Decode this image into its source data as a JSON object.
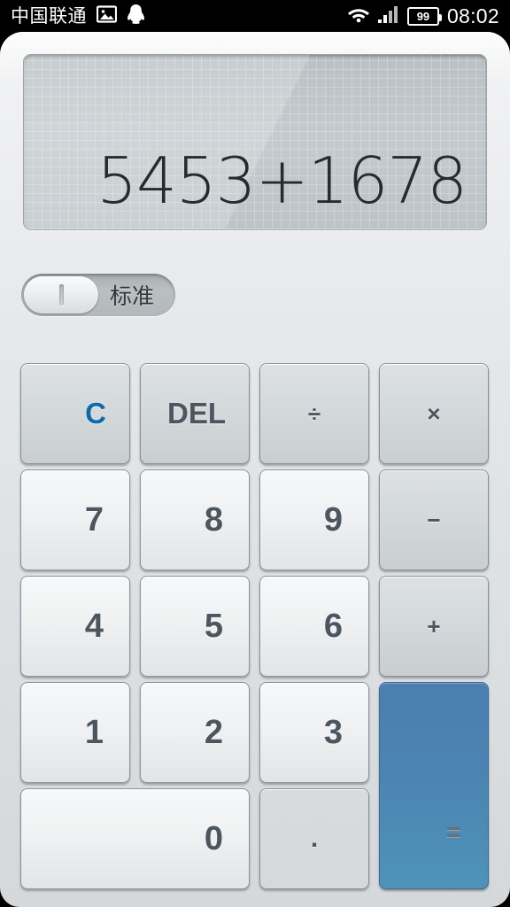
{
  "statusbar": {
    "carrier": "中国联通",
    "icons": [
      "photo-icon",
      "qq-penguin-icon",
      "wifi-icon",
      "signal-icon"
    ],
    "battery_level": "99",
    "time": "08:02"
  },
  "calculator": {
    "display_value": "5453+1678",
    "mode_toggle": {
      "label": "标准",
      "state": "on"
    },
    "accent_color": "#4b84b2",
    "clear_color": "#0f6aa8",
    "keys": [
      {
        "id": "clear",
        "label": "C",
        "type": "func",
        "row": 0,
        "col": 0,
        "span": 1
      },
      {
        "id": "delete",
        "label": "DEL",
        "type": "func",
        "row": 0,
        "col": 1,
        "span": 1
      },
      {
        "id": "divide",
        "label": "÷",
        "type": "op",
        "row": 0,
        "col": 2,
        "span": 1
      },
      {
        "id": "multiply",
        "label": "×",
        "type": "op",
        "row": 0,
        "col": 3,
        "span": 1
      },
      {
        "id": "seven",
        "label": "7",
        "type": "digit",
        "row": 1,
        "col": 0,
        "span": 1
      },
      {
        "id": "eight",
        "label": "8",
        "type": "digit",
        "row": 1,
        "col": 1,
        "span": 1
      },
      {
        "id": "nine",
        "label": "9",
        "type": "digit",
        "row": 1,
        "col": 2,
        "span": 1
      },
      {
        "id": "minus",
        "label": "−",
        "type": "op",
        "row": 1,
        "col": 3,
        "span": 1
      },
      {
        "id": "four",
        "label": "4",
        "type": "digit",
        "row": 2,
        "col": 0,
        "span": 1
      },
      {
        "id": "five",
        "label": "5",
        "type": "digit",
        "row": 2,
        "col": 1,
        "span": 1
      },
      {
        "id": "six",
        "label": "6",
        "type": "digit",
        "row": 2,
        "col": 2,
        "span": 1
      },
      {
        "id": "plus",
        "label": "+",
        "type": "op",
        "row": 2,
        "col": 3,
        "span": 1
      },
      {
        "id": "one",
        "label": "1",
        "type": "digit",
        "row": 3,
        "col": 0,
        "span": 1
      },
      {
        "id": "two",
        "label": "2",
        "type": "digit",
        "row": 3,
        "col": 1,
        "span": 1
      },
      {
        "id": "three",
        "label": "3",
        "type": "digit",
        "row": 3,
        "col": 2,
        "span": 1
      },
      {
        "id": "zero",
        "label": "0",
        "type": "digit",
        "row": 4,
        "col": 0,
        "span": 2
      },
      {
        "id": "decimal",
        "label": ".",
        "type": "dot",
        "row": 4,
        "col": 2,
        "span": 1
      },
      {
        "id": "equals",
        "label": "=",
        "type": "equals",
        "row": 3,
        "col": 3,
        "span": 1,
        "rowspan": 2
      }
    ]
  }
}
